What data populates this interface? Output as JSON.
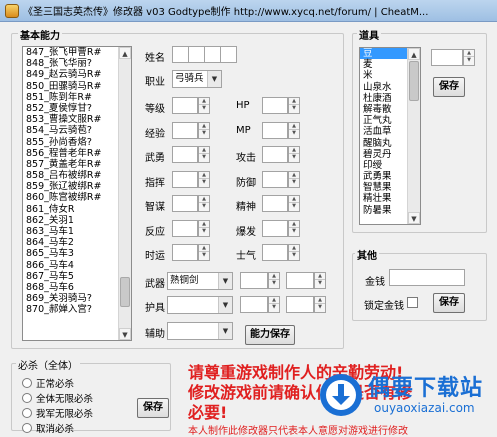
{
  "window": {
    "title": "《圣三国志英杰传》修改器 v03  Godtype制作 http://www.xycq.net/forum/ | CheatM..."
  },
  "basic": {
    "group_label": "基本能力",
    "list": [
      "847_张飞甲曹R#",
      "848_张飞华丽?",
      "849_赵云骑马R#",
      "850_田骡骑马R#",
      "851_陈到年R#",
      "852_夏侯惇甘?",
      "853_曹操文服R#",
      "854_马云骑苞?",
      "855_孙尚香烙?",
      "856_程普老年R#",
      "857_黄盖老年R#",
      "858_吕布被绑R#",
      "859_张辽被绑R#",
      "860_陈宫被绑R#",
      "861_侍女R",
      "862_关羽1",
      "863_马车1",
      "864_马车2",
      "865_马车3",
      "866_马车4",
      "867_马车5",
      "868_马车6",
      "869_关羽骑马?",
      "870_郝婵入宫?"
    ],
    "name_label": "姓名",
    "job_label": "职业",
    "job_value": "弓骑兵",
    "stats_left": [
      "等级",
      "经验",
      "武勇",
      "指挥",
      "智谋",
      "反应",
      "时运"
    ],
    "stats_right": [
      "HP",
      "MP",
      "攻击",
      "防御",
      "精神",
      "爆发",
      "士气"
    ],
    "weapon_label": "武器",
    "weapon_value": "熟铜剑",
    "armor_label": "护具",
    "aux_label": "辅助",
    "save_button": "能力保存"
  },
  "items": {
    "group_label": "道具",
    "list": [
      "豆",
      "麦",
      "米",
      "山泉水",
      "杜康酒",
      "解毒散",
      "正气丸",
      "活血草",
      "醒脑丸",
      "碧灵丹",
      "印绶",
      "武勇果",
      "智慧果",
      "精壮果",
      "防暑果"
    ],
    "save_button": "保存"
  },
  "other": {
    "group_label": "其他",
    "gold_label": "金钱",
    "lock_gold_label": "锁定金钱",
    "save_button": "保存"
  },
  "kill": {
    "group_label": "必杀（全体）",
    "options": [
      "正常必杀",
      "全体无限必杀",
      "我军无限必杀",
      "取消必杀"
    ],
    "save_button": "保存"
  },
  "notice": {
    "line1": "请尊重游戏制作人的辛勤劳动!",
    "line2": "修改游戏前请确认修改是否有修",
    "line3": "必要!",
    "line4": "本人制作此修改器只代表本人意愿对游戏进行修改"
  },
  "watermark": {
    "brand": "偶要下载站",
    "url": "ouyaoxiazai.com"
  },
  "colors": {
    "selection": "#3399ff",
    "notice": "#e02020",
    "brand_blue": "#1a6fd4"
  }
}
